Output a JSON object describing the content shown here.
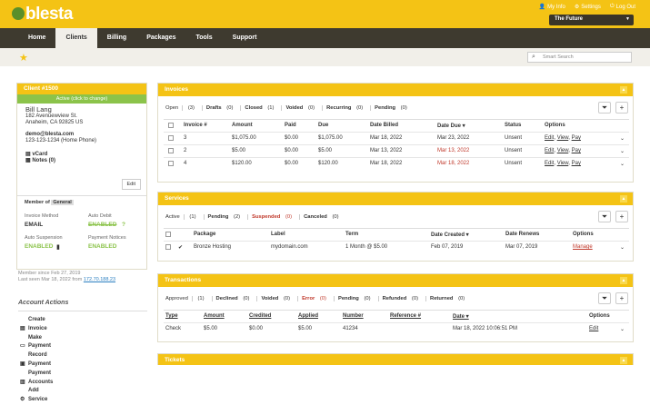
{
  "brand": {
    "name": "blesta"
  },
  "toplinks": {
    "myinfo": "My Info",
    "settings": "Settings",
    "logout": "Log Out"
  },
  "company": {
    "selected": "The Future"
  },
  "nav": [
    "Home",
    "Clients",
    "Billing",
    "Packages",
    "Tools",
    "Support"
  ],
  "search": {
    "placeholder": "Smart Search"
  },
  "client": {
    "header": "Client #1500",
    "status": "Active (click to change)",
    "name": "Bill Lang",
    "address1": "182 Avenuewview St.",
    "address2": "Anaheim, CA 92825 US",
    "email": "demo@blesta.com",
    "phone": "123-123-1234 (Home Phone)",
    "vcard": "vCard",
    "notes": "Notes (0)",
    "edit": "Edit",
    "member_of": "Member of",
    "group": "General",
    "invoice_method_label": "Invoice Method",
    "invoice_method": "EMAIL",
    "auto_debit_label": "Auto Debit",
    "auto_debit": "ENABLED",
    "auto_suspension_label": "Auto Suspension",
    "auto_suspension": "ENABLED",
    "payment_notices_label": "Payment Notices",
    "payment_notices": "ENABLED",
    "member_since": "Member since Feb 27, 2019",
    "last_seen": "Last seen Mar 18, 2022 from",
    "last_ip": "172.70.188.23"
  },
  "account_actions": {
    "title": "Account Actions",
    "items": [
      "Create Invoice",
      "Make Payment",
      "Record Payment",
      "Payment Accounts",
      "Add Service"
    ]
  },
  "invoices": {
    "title": "Invoices",
    "tabs": [
      {
        "label": "Open",
        "count": "(3)"
      },
      {
        "label": "Drafts",
        "count": "(0)"
      },
      {
        "label": "Closed",
        "count": "(1)"
      },
      {
        "label": "Voided",
        "count": "(0)"
      },
      {
        "label": "Recurring",
        "count": "(0)"
      },
      {
        "label": "Pending",
        "count": "(0)"
      }
    ],
    "columns": [
      "Invoice #",
      "Amount",
      "Paid",
      "Due",
      "Date Billed",
      "Date Due",
      "Status",
      "Options"
    ],
    "rows": [
      {
        "id": "3",
        "amount": "$1,075.00",
        "paid": "$0.00",
        "due": "$1,075.00",
        "billed": "Mar 18, 2022",
        "date_due": "Mar 23, 2022",
        "status": "Unsent"
      },
      {
        "id": "2",
        "amount": "$5.00",
        "paid": "$0.00",
        "due": "$5.00",
        "billed": "Mar 13, 2022",
        "date_due": "Mar 13, 2022",
        "status": "Unsent"
      },
      {
        "id": "4",
        "amount": "$120.00",
        "paid": "$0.00",
        "due": "$120.00",
        "billed": "Mar 18, 2022",
        "date_due": "Mar 18, 2022",
        "status": "Unsent"
      }
    ],
    "opt_edit": "Edit",
    "opt_view": "View",
    "opt_pay": "Pay"
  },
  "services": {
    "title": "Services",
    "tabs": [
      {
        "label": "Active",
        "count": "(1)"
      },
      {
        "label": "Pending",
        "count": "(2)"
      },
      {
        "label": "Suspended",
        "count": "(0)"
      },
      {
        "label": "Canceled",
        "count": "(0)"
      }
    ],
    "columns": [
      "Package",
      "Label",
      "Term",
      "Date Created",
      "Date Renews",
      "Options"
    ],
    "rows": [
      {
        "package": "Bronze Hosting",
        "label": "mydomain.com",
        "term": "1 Month @ $5.00",
        "created": "Feb 07, 2019",
        "renews": "Mar 07, 2019",
        "option": "Manage"
      }
    ]
  },
  "transactions": {
    "title": "Transactions",
    "tabs": [
      {
        "label": "Approved",
        "count": "(1)"
      },
      {
        "label": "Declined",
        "count": "(0)"
      },
      {
        "label": "Voided",
        "count": "(0)"
      },
      {
        "label": "Error",
        "count": "(0)"
      },
      {
        "label": "Pending",
        "count": "(0)"
      },
      {
        "label": "Refunded",
        "count": "(0)"
      },
      {
        "label": "Returned",
        "count": "(0)"
      }
    ],
    "columns": [
      "Type",
      "Amount",
      "Credited",
      "Applied",
      "Number",
      "Reference #",
      "Date",
      "Options"
    ],
    "rows": [
      {
        "type": "Check",
        "amount": "$5.00",
        "credited": "$0.00",
        "applied": "$5.00",
        "number": "41234",
        "reference": "",
        "date": "Mar 18, 2022 10:06:51 PM",
        "option": "Edit"
      }
    ]
  },
  "tickets": {
    "title": "Tickets"
  },
  "colors": {
    "accent": "#f4c315",
    "nav": "#3e3a2f",
    "green": "#8bc34a",
    "red": "#c0392b"
  }
}
